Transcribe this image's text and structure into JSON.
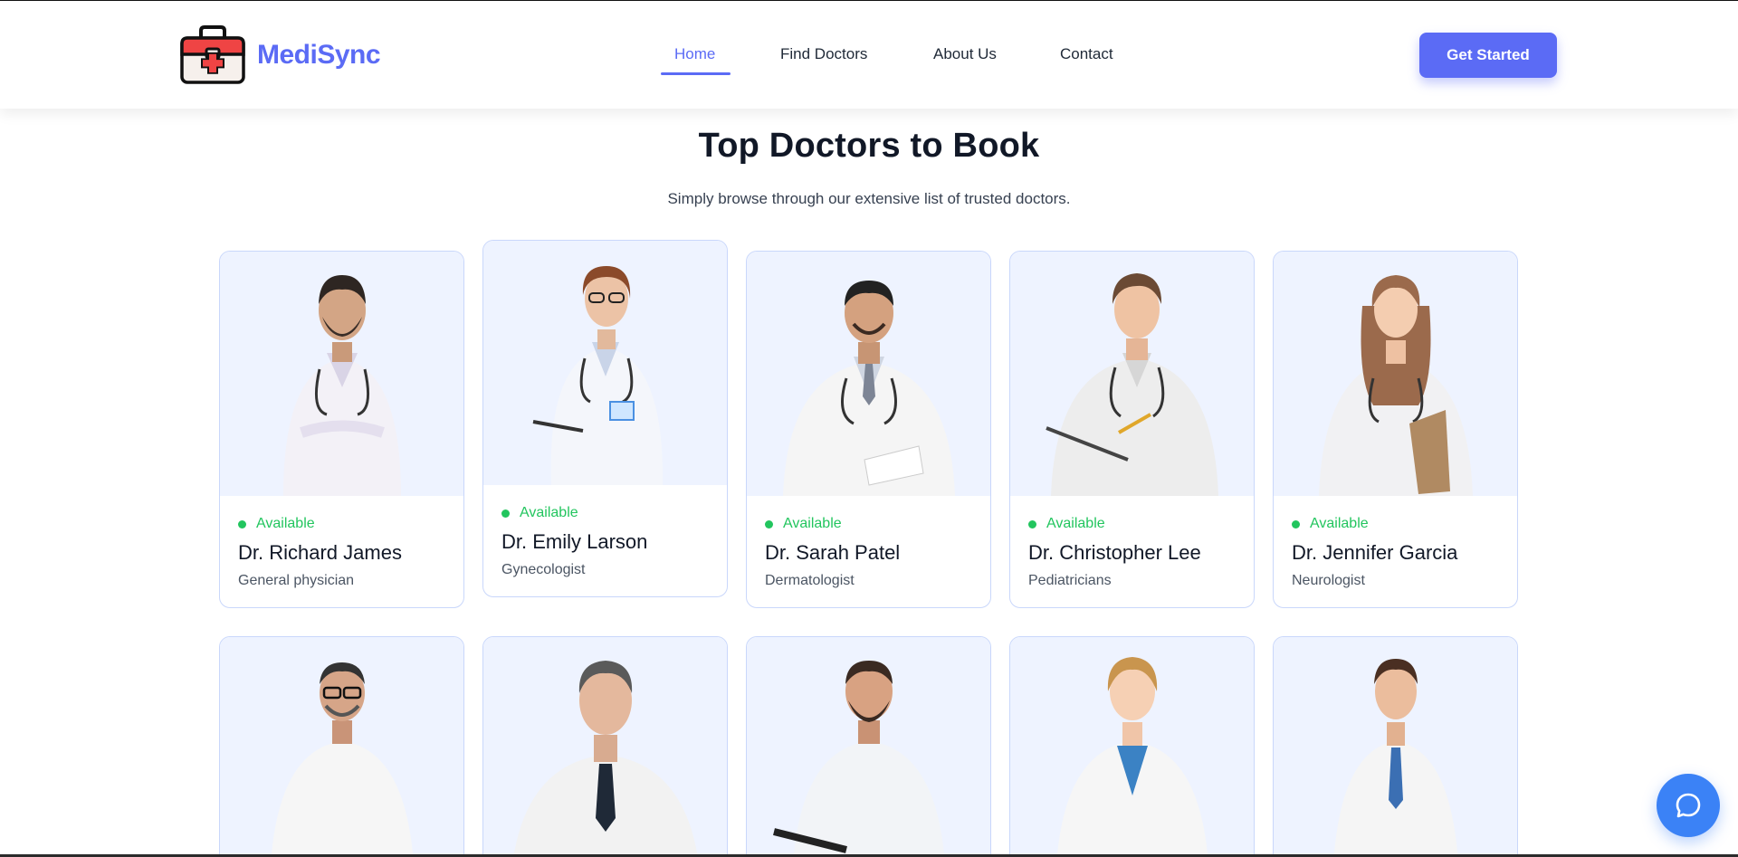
{
  "brand": {
    "name": "MediSync",
    "logo_icon": "medical-kit-icon",
    "accent": "#5b6bf5"
  },
  "nav": {
    "items": [
      {
        "label": "Home",
        "active": true
      },
      {
        "label": "Find Doctors",
        "active": false
      },
      {
        "label": "About Us",
        "active": false
      },
      {
        "label": "Contact",
        "active": false
      }
    ],
    "cta_label": "Get Started"
  },
  "section": {
    "title": "Top Doctors to Book",
    "subtitle": "Simply browse through our extensive list of trusted doctors."
  },
  "doctors": [
    {
      "status": "Available",
      "name": "Dr. Richard James",
      "specialty": "General physician"
    },
    {
      "status": "Available",
      "name": "Dr. Emily Larson",
      "specialty": "Gynecologist"
    },
    {
      "status": "Available",
      "name": "Dr. Sarah Patel",
      "specialty": "Dermatologist"
    },
    {
      "status": "Available",
      "name": "Dr. Christopher Lee",
      "specialty": "Pediatricians"
    },
    {
      "status": "Available",
      "name": "Dr. Jennifer Garcia",
      "specialty": "Neurologist"
    }
  ],
  "status_color": "#22c55e",
  "chat": {
    "icon": "chat-bubble-icon",
    "color": "#3b82f6"
  }
}
